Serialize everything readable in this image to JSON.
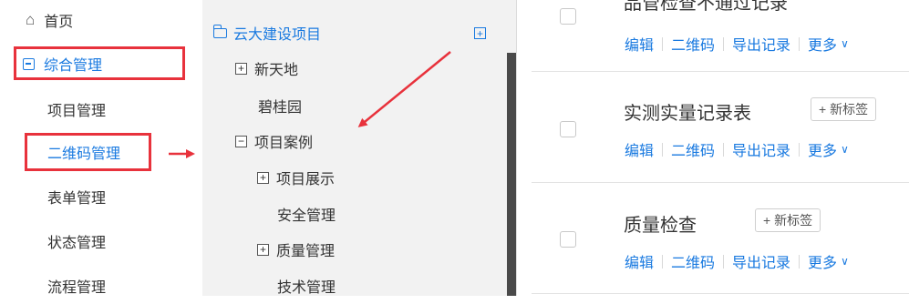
{
  "nav": {
    "home": "首页",
    "group": "综合管理",
    "items": [
      "项目管理",
      "二维码管理",
      "表单管理",
      "状态管理",
      "流程管理"
    ]
  },
  "tree": {
    "root": "云大建设项目",
    "items": [
      "新天地",
      "碧桂园",
      "项目案例",
      "项目展示",
      "安全管理",
      "质量管理",
      "技术管理"
    ],
    "expand_symbol": "+",
    "collapse_symbol": "−"
  },
  "records": {
    "cut_title": "品管检查不通过记录",
    "items": [
      {
        "title": "实测实量记录表",
        "tag": "+ 新标签"
      },
      {
        "title": "质量检查",
        "tag": "+ 新标签"
      }
    ],
    "actions": {
      "edit": "编辑",
      "qrcode": "二维码",
      "export": "导出记录",
      "more": "更多"
    }
  },
  "colors": {
    "accent": "#1a7ae0",
    "annotation": "#e8323c",
    "tree_bg": "#f2f2f2"
  }
}
